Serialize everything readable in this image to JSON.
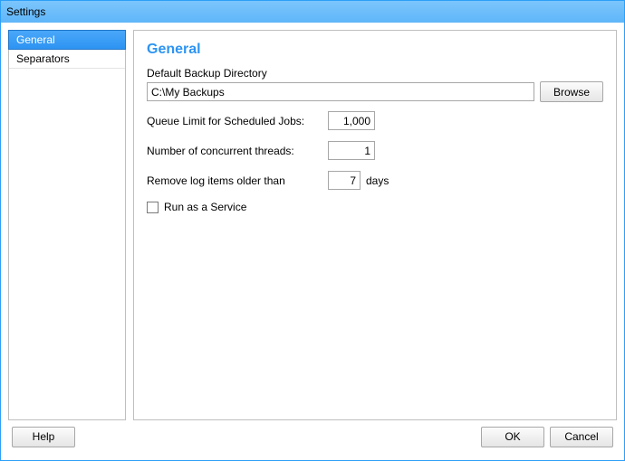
{
  "window": {
    "title": "Settings"
  },
  "nav": {
    "items": [
      {
        "label": "General",
        "selected": true
      },
      {
        "label": "Separators",
        "selected": false
      }
    ]
  },
  "panel": {
    "heading": "General",
    "backup_dir_label": "Default Backup Directory",
    "backup_dir_value": "C:\\My Backups",
    "browse_label": "Browse",
    "queue_limit_label": "Queue Limit for Scheduled Jobs:",
    "queue_limit_value": "1,000",
    "threads_label": "Number of concurrent threads:",
    "threads_value": "1",
    "log_age_label": "Remove log items older than",
    "log_age_value": "7",
    "log_age_suffix": "days",
    "run_service_label": "Run as a Service",
    "run_service_checked": false
  },
  "footer": {
    "help_label": "Help",
    "ok_label": "OK",
    "cancel_label": "Cancel"
  }
}
